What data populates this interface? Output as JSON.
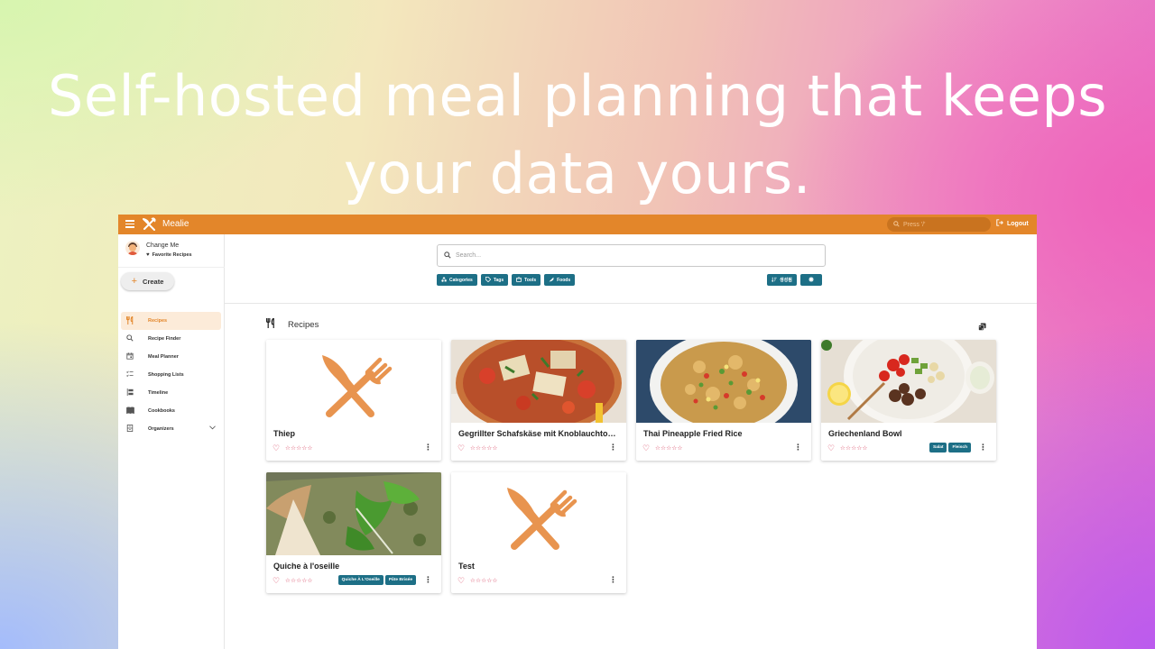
{
  "hero": {
    "line1": "Self-hosted meal planning that keeps",
    "line2": "your data yours."
  },
  "topbar": {
    "app_name": "Mealie",
    "search_placeholder": "Press '/'",
    "logout_label": "Logout",
    "accent_color": "#e3862a"
  },
  "sidebar": {
    "user_name": "Change Me",
    "favorites_label": "Favorite Recipes",
    "create_label": "Create",
    "items": [
      {
        "label": "Recipes",
        "icon": "fork-knife-icon",
        "active": true
      },
      {
        "label": "Recipe Finder",
        "icon": "search-icon"
      },
      {
        "label": "Meal Planner",
        "icon": "calendar-icon"
      },
      {
        "label": "Shopping Lists",
        "icon": "checklist-icon"
      },
      {
        "label": "Timeline",
        "icon": "timeline-icon"
      },
      {
        "label": "Cookbooks",
        "icon": "book-icon"
      },
      {
        "label": "Organizers",
        "icon": "organizer-icon"
      }
    ]
  },
  "main": {
    "search_placeholder": "Search...",
    "filters": [
      "Categories",
      "Tags",
      "Tools",
      "Foods"
    ],
    "sort_label": "생성됨",
    "section_title": "Recipes",
    "chip_color": "#1d6f86"
  },
  "recipes": [
    {
      "title": "Thiep",
      "image": "placeholder",
      "tags": []
    },
    {
      "title": "Gegrillter Schafskäse mit Knoblauchtomaten",
      "image": "feta-dish",
      "tags": []
    },
    {
      "title": "Thai Pineapple Fried Rice",
      "image": "fried-rice",
      "tags": []
    },
    {
      "title": "Griechenland Bowl",
      "image": "greek-bowl",
      "tags": [
        "Salat",
        "Fleisch"
      ]
    },
    {
      "title": "Quiche à l'oseille",
      "image": "quiche",
      "tags": [
        "Quiche À L'Oseille",
        "Pâte Brisée"
      ]
    },
    {
      "title": "Test",
      "image": "placeholder",
      "tags": []
    }
  ],
  "rating_stars": "☆☆☆☆☆"
}
